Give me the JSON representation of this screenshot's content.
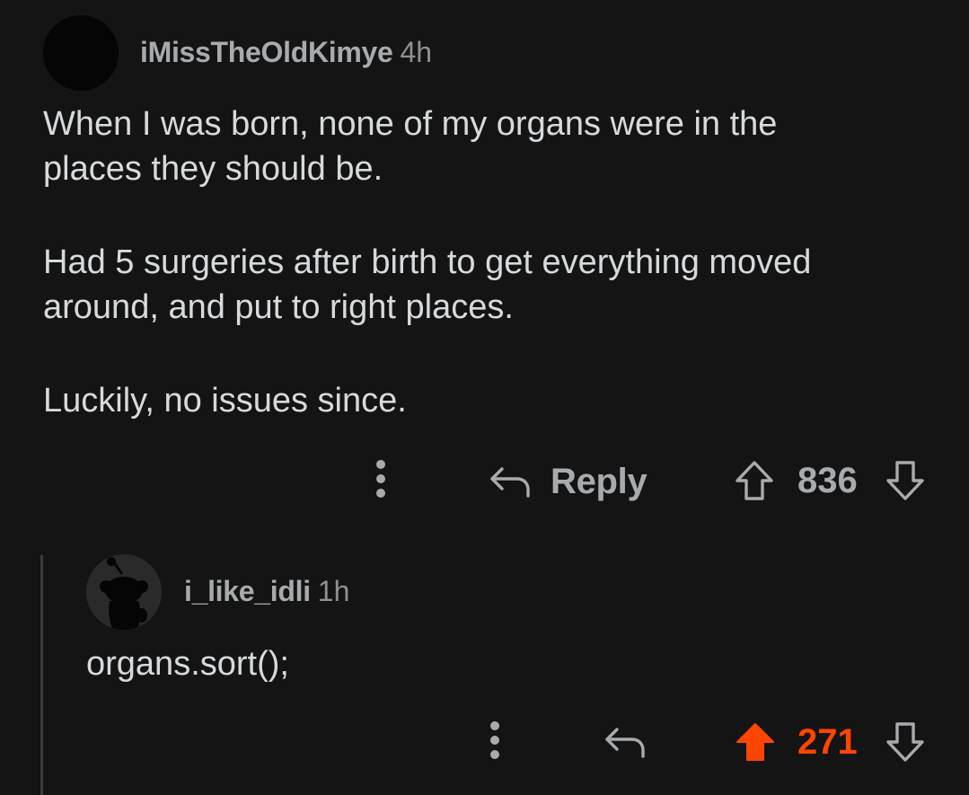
{
  "comment": {
    "author": "iMissTheOldKimye",
    "time": "4h",
    "paragraphs": [
      [
        "When I was born, none of my organs were in the",
        "places they should be."
      ],
      [
        "Had 5 surgeries after birth to get everything moved",
        "around, and put to right places."
      ],
      [
        "Luckily, no issues since."
      ]
    ],
    "reply_label": "Reply",
    "score": "836",
    "vote_state": "none"
  },
  "reply": {
    "author": "i_like_idli",
    "time": "1h",
    "text": "organs.sort();",
    "score": "271",
    "vote_state": "upvoted"
  },
  "icons": {
    "more": "more-vertical-icon",
    "reply": "reply-arrow-icon",
    "upvote": "upvote-arrow-icon",
    "downvote": "downvote-arrow-icon",
    "avatar": "snoo-avatar-icon"
  },
  "colors": {
    "background": "#141414",
    "text": "#d7dadc",
    "muted": "#a8abae",
    "upvote_active": "#ff4500",
    "thread_line": "#3a3a3c"
  }
}
